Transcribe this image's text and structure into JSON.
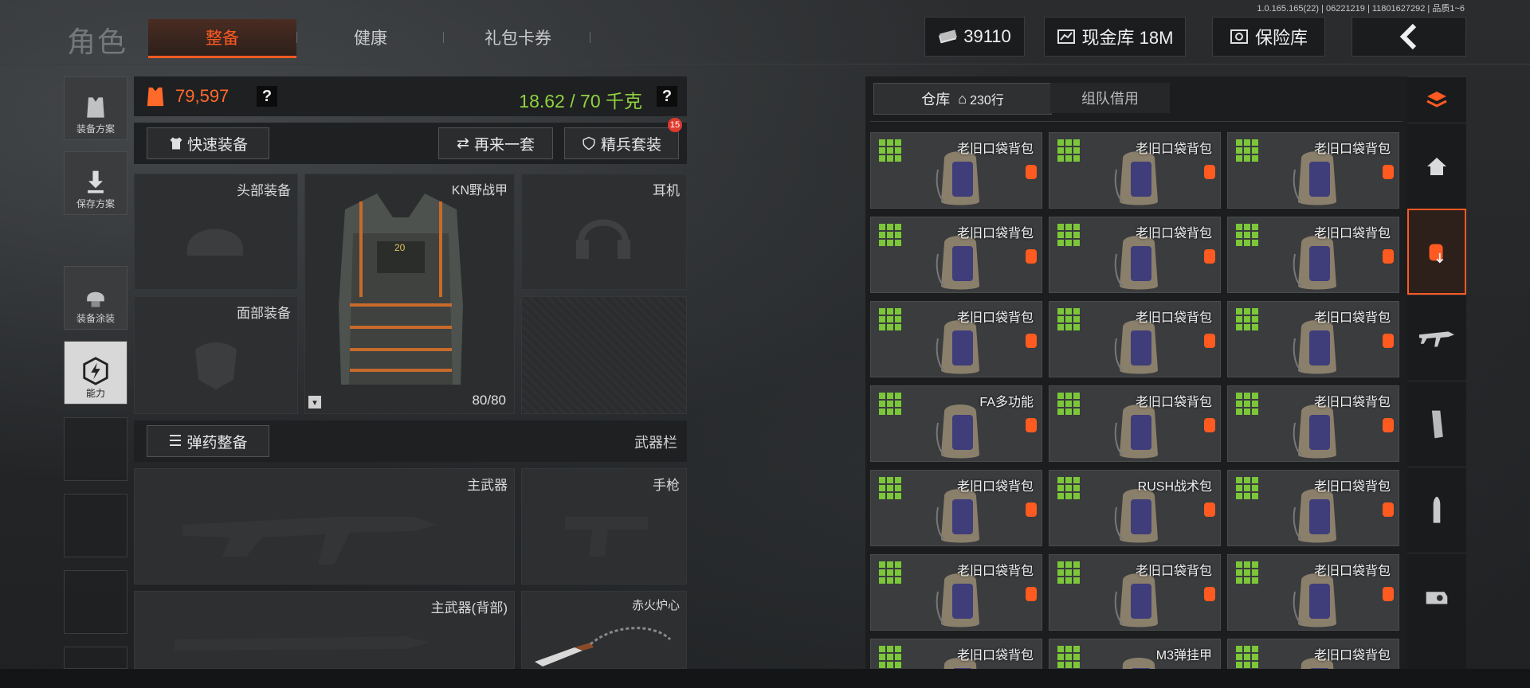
{
  "version": "1.0.165.165(22) | 06221219 | 11801627292 | 品质1~6",
  "header": {
    "title": "角色",
    "tabs": [
      {
        "label": "整备",
        "active": true
      },
      {
        "label": "健康",
        "active": false
      },
      {
        "label": "礼包卡券",
        "active": false
      }
    ],
    "currency": "39110",
    "cash_button": "现金库 18M",
    "safe_button": "保险库"
  },
  "sidebar": {
    "items": [
      {
        "label": "装备方案"
      },
      {
        "label": "保存方案"
      },
      {
        "label": "装备涂装"
      },
      {
        "label": "能力",
        "active": true
      }
    ]
  },
  "equipment": {
    "value": "79,597",
    "help": "?",
    "weight": "18.62 / 70 千克",
    "weight_help": "?",
    "quick_equip": "快速装备",
    "again": "再来一套",
    "elite": "精兵套装",
    "elite_badge": "15",
    "slots": {
      "head": "头部装备",
      "armor_name": "KN野战甲",
      "armor_durability": "80/80",
      "headset": "耳机",
      "face": "面部装备"
    },
    "ammo_button": "弹药整备",
    "weapon_bar": "武器栏",
    "primary": "主武器",
    "pistol": "手枪",
    "primary_back": "主武器(背部)",
    "melee": "赤火炉心"
  },
  "warehouse": {
    "tab_storage": "仓库",
    "tab_storage_count": "230行",
    "tab_team": "组队借用",
    "items": [
      "老旧口袋背包",
      "老旧口袋背包",
      "老旧口袋背包",
      "老旧口袋背包",
      "老旧口袋背包",
      "老旧口袋背包",
      "老旧口袋背包",
      "老旧口袋背包",
      "老旧口袋背包",
      "FA多功能",
      "老旧口袋背包",
      "老旧口袋背包",
      "老旧口袋背包",
      "RUSH战术包",
      "老旧口袋背包",
      "老旧口袋背包",
      "老旧口袋背包",
      "老旧口袋背包",
      "老旧口袋背包",
      "M3弹挂甲",
      "老旧口袋背包"
    ]
  },
  "rail": {
    "items": [
      "storage-stack-icon",
      "home-icon",
      "backpack-download-icon",
      "rifle-icon",
      "magazine-icon",
      "ammo-icon",
      "scope-icon"
    ]
  },
  "colors": {
    "accent": "#ff5a22",
    "weight_green": "#8fd23f",
    "value_orange": "#ff6a2a",
    "grid_green": "#7cc63a"
  }
}
